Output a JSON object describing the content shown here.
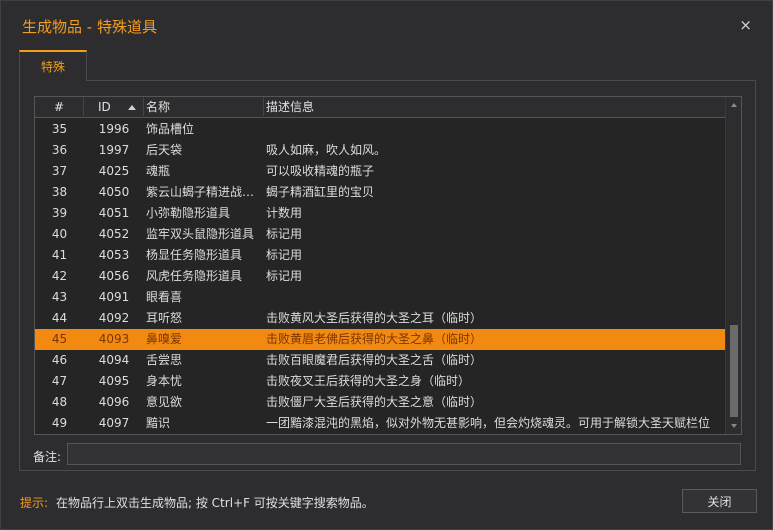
{
  "window": {
    "title": "生成物品 - 特殊道具",
    "close_glyph": "×"
  },
  "tabs": [
    {
      "label": "特殊",
      "active": true
    }
  ],
  "grid": {
    "columns": [
      "#",
      "ID",
      "名称",
      "描述信息"
    ],
    "sort_column": "ID",
    "sort_direction": "ascending",
    "selected_row_number": "45",
    "rows": [
      {
        "num": "35",
        "id": "1996",
        "name": "饰品槽位",
        "desc": ""
      },
      {
        "num": "36",
        "id": "1997",
        "name": "后天袋",
        "desc": "吸人如麻，吹人如风。"
      },
      {
        "num": "37",
        "id": "4025",
        "name": "魂瓶",
        "desc": "可以吸收精魂的瓶子"
      },
      {
        "num": "38",
        "id": "4050",
        "name": "紫云山蝎子精进战…",
        "desc": "蝎子精酒缸里的宝贝"
      },
      {
        "num": "39",
        "id": "4051",
        "name": "小弥勒隐形道具",
        "desc": "计数用"
      },
      {
        "num": "40",
        "id": "4052",
        "name": "监牢双头鼠隐形道具",
        "desc": "标记用"
      },
      {
        "num": "41",
        "id": "4053",
        "name": "杨显任务隐形道具",
        "desc": "标记用"
      },
      {
        "num": "42",
        "id": "4056",
        "name": "风虎任务隐形道具",
        "desc": "标记用"
      },
      {
        "num": "43",
        "id": "4091",
        "name": "眼看喜",
        "desc": ""
      },
      {
        "num": "44",
        "id": "4092",
        "name": "耳听怒",
        "desc": "击败黄风大圣后获得的大圣之耳（临时）"
      },
      {
        "num": "45",
        "id": "4093",
        "name": "鼻嗅爱",
        "desc": "击败黄眉老佛后获得的大圣之鼻（临时）"
      },
      {
        "num": "46",
        "id": "4094",
        "name": "舌尝思",
        "desc": "击败百眼魔君后获得的大圣之舌（临时）"
      },
      {
        "num": "47",
        "id": "4095",
        "name": "身本忧",
        "desc": "击败夜叉王后获得的大圣之身（临时）"
      },
      {
        "num": "48",
        "id": "4096",
        "name": "意见欲",
        "desc": "击败僵尸大圣后获得的大圣之意（临时）"
      },
      {
        "num": "49",
        "id": "4097",
        "name": "黯识",
        "desc": "一团黯漆混沌的黑焰，似对外物无甚影响，但会灼烧魂灵。可用于解锁大圣天赋栏位"
      }
    ],
    "scroll_position_fraction": 0.85
  },
  "notes": {
    "label": "备注:",
    "value": ""
  },
  "footer": {
    "hint_label": "提示:",
    "hint_text": "在物品行上双击生成物品; 按 Ctrl+F 可按关键字搜索物品。",
    "close_button": "关闭"
  },
  "colors": {
    "accent": "#f39c1f",
    "selected_row_bg": "#f28a12",
    "background": "#2d2d30"
  }
}
